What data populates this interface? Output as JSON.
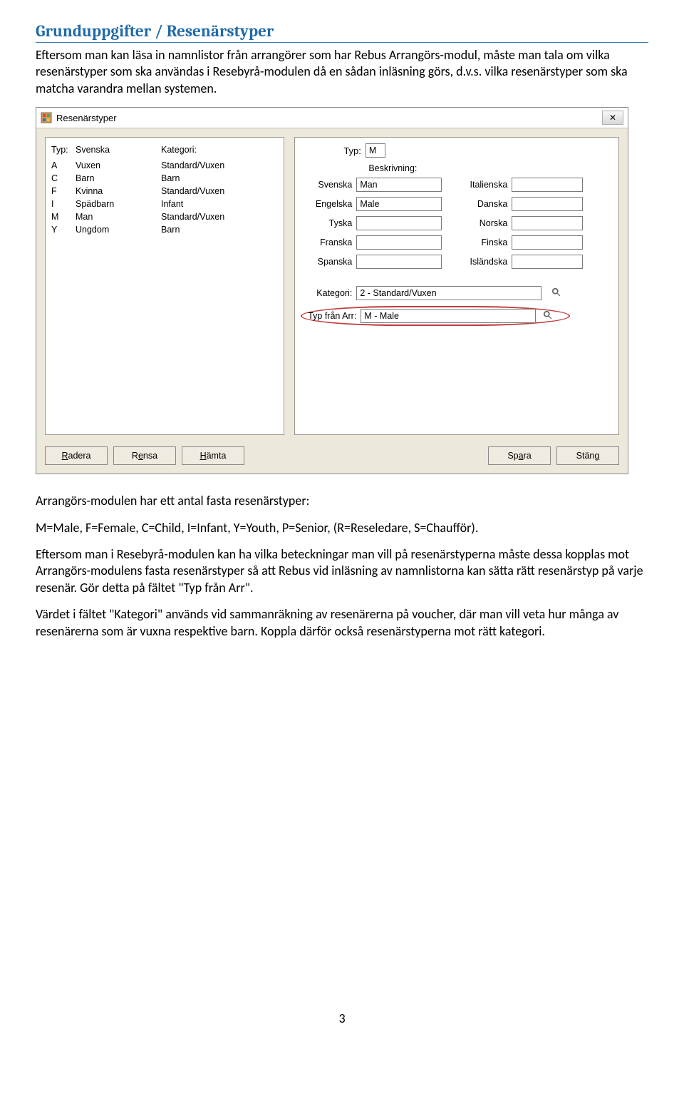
{
  "doc": {
    "heading": "Grunduppgifter / Resenärstyper",
    "para1": "Eftersom man kan läsa in namnlistor från arrangörer som har Rebus Arrangörs-modul, måste man tala om vilka resenärstyper som ska användas i Resebyrå-modulen då en sådan inläsning görs, d.v.s. vilka resenärstyper som ska matcha varandra mellan systemen.",
    "para2": "Arrangörs-modulen har ett antal fasta resenärstyper:",
    "para3": "M=Male, F=Female, C=Child, I=Infant, Y=Youth, P=Senior, (R=Reseledare, S=Chaufför).",
    "para4": "Eftersom man i Resebyrå-modulen kan ha vilka beteckningar man vill på resenärstyperna måste dessa kopplas mot Arrangörs-modulens fasta resenärstyper så att Rebus vid inläsning av namnlistorna kan sätta rätt resenärstyp på varje resenär. Gör detta på fältet \"Typ från Arr\".",
    "para5": "Värdet i fältet \"Kategori\" används vid sammanräkning av resenärerna på voucher, där man vill veta hur många av resenärerna som är vuxna respektive barn. Koppla därför också resenärstyperna mot rätt kategori.",
    "pagenum": "3"
  },
  "dialog": {
    "title": "Resenärstyper",
    "close_x": "✕",
    "headers": {
      "typ": "Typ:",
      "svenska": "Svenska",
      "kategori": "Kategori:"
    },
    "rows": [
      {
        "code": "A",
        "sv": "Vuxen",
        "cat": "Standard/Vuxen"
      },
      {
        "code": "C",
        "sv": "Barn",
        "cat": "Barn"
      },
      {
        "code": "F",
        "sv": "Kvinna",
        "cat": "Standard/Vuxen"
      },
      {
        "code": "I",
        "sv": "Spädbarn",
        "cat": "Infant"
      },
      {
        "code": "M",
        "sv": "Man",
        "cat": "Standard/Vuxen"
      },
      {
        "code": "Y",
        "sv": "Ungdom",
        "cat": "Barn"
      }
    ],
    "form": {
      "typ_label": "Typ:",
      "typ_value": "M",
      "beskrivning_label": "Beskrivning:",
      "svenska_label": "Svenska",
      "svenska_value": "Man",
      "italienska_label": "Italienska",
      "italienska_value": "",
      "engelska_label": "Engelska",
      "engelska_value": "Male",
      "danska_label": "Danska",
      "danska_value": "",
      "tyska_label": "Tyska",
      "tyska_value": "",
      "norska_label": "Norska",
      "norska_value": "",
      "franska_label": "Franska",
      "franska_value": "",
      "finska_label": "Finska",
      "finska_value": "",
      "spanska_label": "Spanska",
      "spanska_value": "",
      "islandska_label": "Isländska",
      "islandska_value": "",
      "kategori_label": "Kategori:",
      "kategori_value": "2  - Standard/Vuxen",
      "typ_arr_label": "Typ från Arr:",
      "typ_arr_value": "M - Male"
    },
    "buttons": {
      "radera": "Radera",
      "rensa": "Rensa",
      "hamta": "Hämta",
      "spara": "Spara",
      "stang": "Stäng"
    }
  }
}
